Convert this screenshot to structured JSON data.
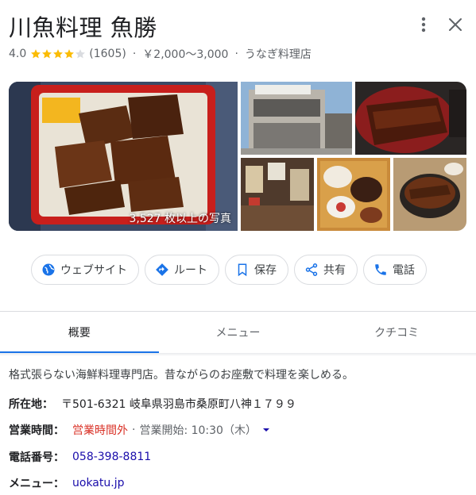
{
  "header": {
    "title": "川魚料理 魚勝"
  },
  "meta": {
    "rating": "4.0",
    "rating_value": 4.0,
    "review_count": "(1605)",
    "price_range": "￥2,000～3,000",
    "category": "うなぎ料理店"
  },
  "photos": {
    "count_label": "3,527 枚以上の写真"
  },
  "actions": {
    "website": "ウェブサイト",
    "route": "ルート",
    "save": "保存",
    "share": "共有",
    "call": "電話"
  },
  "tabs": [
    "概要",
    "メニュー",
    "クチコミ"
  ],
  "description": "格式張らない海鮮料理専門店。昔ながらのお座敷で料理を楽しめる。",
  "info": {
    "address_label": "所在地：",
    "address": "〒501-6321 岐阜県羽島市桑原町八神１７９９",
    "hours_label": "営業時間：",
    "hours_status": "営業時間外",
    "hours_next": "営業開始: 10:30（木）",
    "phone_label": "電話番号：",
    "phone": "058-398-8811",
    "menu_label": "メニュー：",
    "menu_link": "uokatu.jp"
  },
  "colors": {
    "accent": "#1a73e8",
    "closed": "#d93025",
    "star": "#fbbc04",
    "link": "#1a0dab"
  }
}
